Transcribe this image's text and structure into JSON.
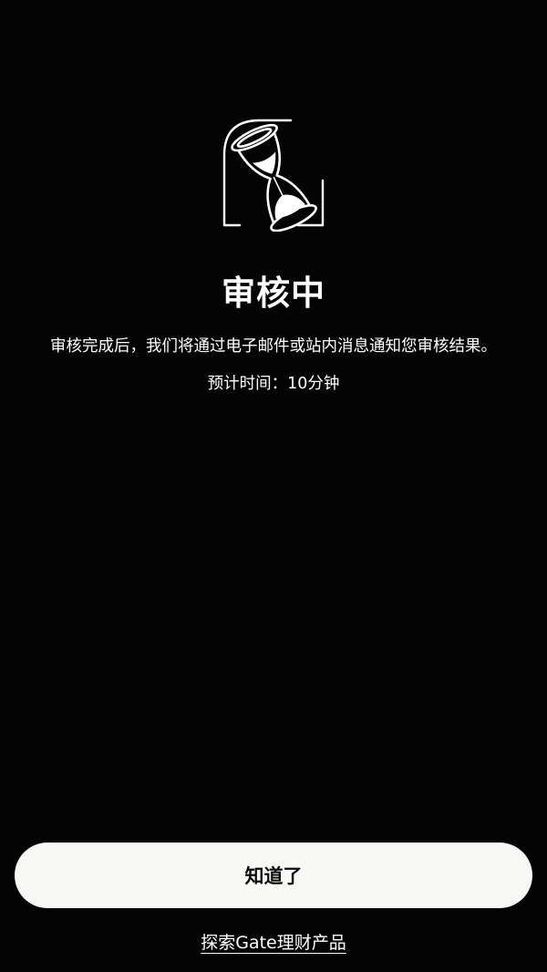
{
  "status": {
    "icon": "hourglass-icon",
    "title": "审核中",
    "description": "审核完成后，我们将通过电子邮件或站内消息通知您审核结果。",
    "eta": "预计时间：10分钟"
  },
  "actions": {
    "confirm_label": "知道了",
    "explore_label": "探索Gate理财产品"
  },
  "colors": {
    "background": "#040404",
    "button_bg": "#f8f8f6",
    "text": "#ffffff"
  }
}
